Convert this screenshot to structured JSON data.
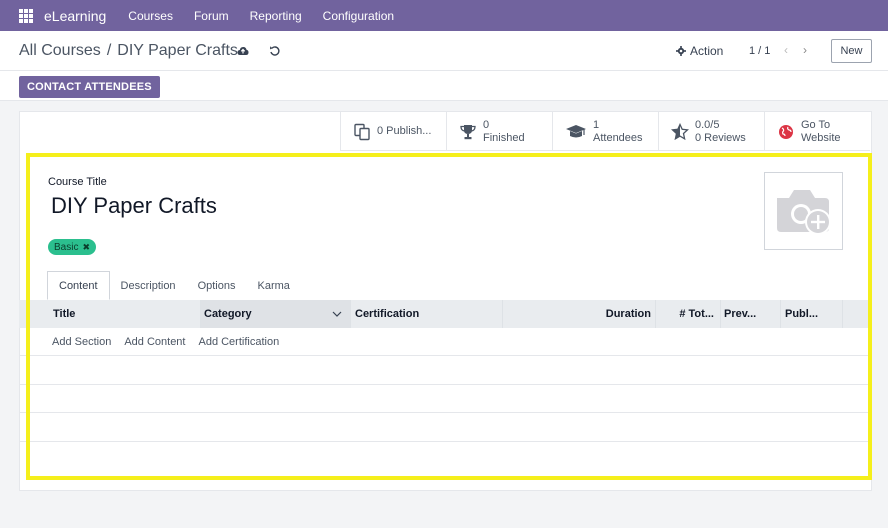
{
  "navbar": {
    "brand": "eLearning",
    "menu": [
      "Courses",
      "Forum",
      "Reporting",
      "Configuration"
    ]
  },
  "control": {
    "breadcrumb_parent": "All Courses",
    "breadcrumb_sep": "/",
    "breadcrumb_current": "DIY Paper Crafts",
    "action_label": "Action",
    "pager": "1 / 1",
    "new_label": "New"
  },
  "status": {
    "contact_label": "CONTACT ATTENDEES"
  },
  "smart_buttons": [
    {
      "line1": "0 Publish...",
      "line2": "",
      "icon": "copy-icon"
    },
    {
      "line1": "0",
      "line2": "Finished",
      "icon": "trophy-icon"
    },
    {
      "line1": "1",
      "line2": "Attendees",
      "icon": "graduation-cap-icon"
    },
    {
      "line1": "0.0/5",
      "line2": "0 Reviews",
      "icon": "star-half-icon"
    },
    {
      "line1": "Go To",
      "line2": "Website",
      "icon": "globe-icon"
    }
  ],
  "form": {
    "title_label": "Course Title",
    "course_name": "DIY Paper Crafts",
    "tag": "Basic"
  },
  "tabs": [
    "Content",
    "Description",
    "Options",
    "Karma"
  ],
  "table": {
    "columns": [
      "Title",
      "Category",
      "Certification",
      "Duration",
      "# Tot...",
      "Prev...",
      "Publ..."
    ],
    "add_links": [
      "Add Section",
      "Add Content",
      "Add Certification"
    ]
  },
  "colors": {
    "primary": "#71639e",
    "tag": "#2bbf8e",
    "highlight": "#f5ef1b"
  }
}
